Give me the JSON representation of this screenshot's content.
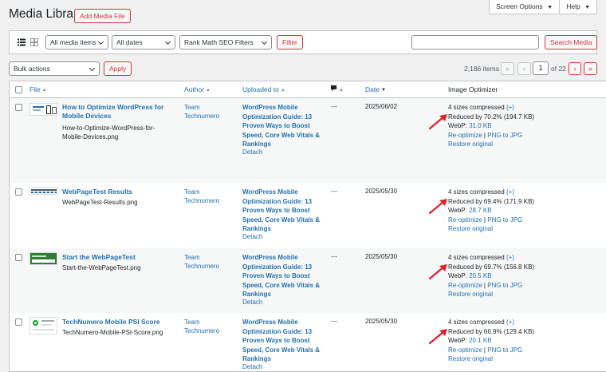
{
  "header": {
    "title": "Media Library",
    "add_button": "Add Media File",
    "screen_options": "Screen Options",
    "help": "Help"
  },
  "filters": {
    "media_type": "All media items",
    "dates": "All dates",
    "seo": "Rank Math SEO Filters",
    "filter_button": "Filter",
    "search_placeholder": "",
    "search_button": "Search Media"
  },
  "bulk": {
    "action": "Bulk actions",
    "apply": "Apply"
  },
  "pagination": {
    "items": "2,186 items",
    "first": "«",
    "prev": "‹",
    "current": "1",
    "of": "of 22",
    "next": "›",
    "last": "»"
  },
  "columns": {
    "file": "File",
    "author": "Author",
    "uploaded": "Uploaded to",
    "date": "Date",
    "optimizer": "Image Optimizer"
  },
  "rows": [
    {
      "title_1": "How to Optimize WordPress for",
      "title_2": "Mobile Devices",
      "file_1": "How-to-Optimize-WordPress-for-",
      "file_2": "Mobile-Devices.png",
      "author_1": "Team",
      "author_2": "Technumero",
      "upl_1": "WordPress Mobile",
      "upl_2": "Optimization Guide: 13",
      "upl_3": "Proven Ways to Boost",
      "upl_4": "Speed, Core Web Vitals &",
      "upl_5": "Rankings",
      "detach": "Detach",
      "comments": "—",
      "date": "2025/06/02",
      "sizes": "4 sizes compressed",
      "plus": "(+)",
      "reduced": "Reduced by 70.2% (194.7 KB)",
      "webp_label": "WebP:",
      "webp_size": "31.0 KB",
      "reoptimize": "Re-optimize",
      "sep": "|",
      "png_to_jpg": "PNG to JPG",
      "restore": "Restore original"
    },
    {
      "title_1": "WebPageTest Results",
      "file_1": "WebPageTest-Results.png",
      "author_1": "Team",
      "author_2": "Technumero",
      "upl_1": "WordPress Mobile",
      "upl_2": "Optimization Guide: 13",
      "upl_3": "Proven Ways to Boost",
      "upl_4": "Speed, Core Web Vitals &",
      "upl_5": "Rankings",
      "detach": "Detach",
      "comments": "—",
      "date": "2025/05/30",
      "sizes": "4 sizes compressed",
      "plus": "(+)",
      "reduced": "Reduced by 69.4% (171.9 KB)",
      "webp_label": "WebP:",
      "webp_size": "28.7 KB",
      "reoptimize": "Re-optimize",
      "sep": "|",
      "png_to_jpg": "PNG to JPG",
      "restore": "Restore original"
    },
    {
      "title_1": "Start the WebPageTest",
      "file_1": "Start-the-WebPageTest.png",
      "author_1": "Team",
      "author_2": "Technumero",
      "upl_1": "WordPress Mobile",
      "upl_2": "Optimization Guide: 13",
      "upl_3": "Proven Ways to Boost",
      "upl_4": "Speed, Core Web Vitals &",
      "upl_5": "Rankings",
      "detach": "Detach",
      "comments": "—",
      "date": "2025/05/30",
      "sizes": "4 sizes compressed",
      "plus": "(+)",
      "reduced": "Reduced by 69.7% (156.8 KB)",
      "webp_label": "WebP:",
      "webp_size": "20.5 KB",
      "reoptimize": "Re-optimize",
      "sep": "|",
      "png_to_jpg": "PNG to JPG",
      "restore": "Restore original"
    },
    {
      "title_1": "TechNumero Mobile PSI Score",
      "file_1": "TechNumero-Mobile-PSI-Score.png",
      "author_1": "Team",
      "author_2": "Technumero",
      "upl_1": "WordPress Mobile",
      "upl_2": "Optimization Guide: 13",
      "upl_3": "Proven Ways to Boost",
      "upl_4": "Speed, Core Web Vitals &",
      "upl_5": "Rankings",
      "detach": "Detach",
      "comments": "—",
      "date": "2025/05/30",
      "sizes": "4 sizes compressed",
      "plus": "(+)",
      "reduced": "Reduced by 66.9% (129.4 KB)",
      "webp_label": "WebP:",
      "webp_size": "20.1 KB",
      "reoptimize": "Re-optimize",
      "sep": "|",
      "png_to_jpg": "PNG to JPG",
      "restore": "Restore original"
    }
  ],
  "colors": {
    "accent_red": "#d63638",
    "link_blue": "#2271b1",
    "annotation_arrow": "#e0202a"
  },
  "icons": {
    "list_view": "list-view-icon",
    "grid_view": "grid-view-icon",
    "comment": "comment-bubble-icon",
    "arrow": "red-annotation-arrow-icon"
  }
}
